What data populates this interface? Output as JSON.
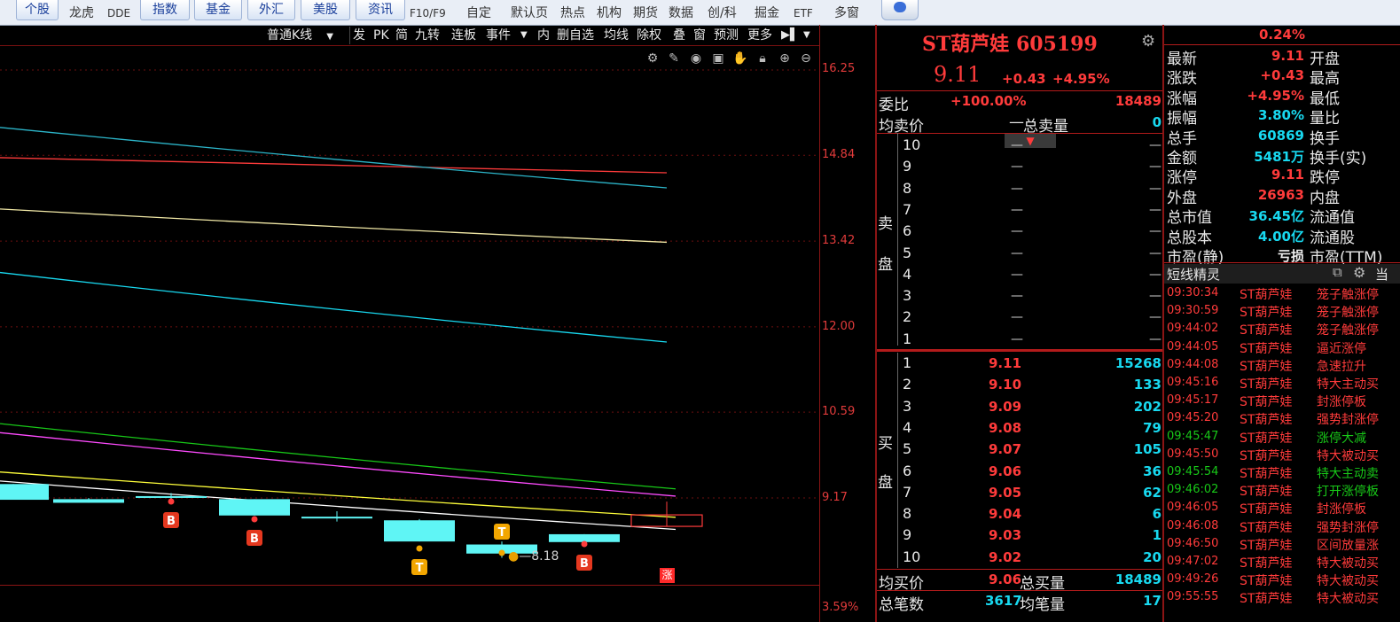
{
  "nav": {
    "buttons": [
      "个股",
      "指数",
      "基金",
      "外汇",
      "美股",
      "资讯"
    ],
    "texts": [
      "龙虎",
      "DDE",
      "F10/F9",
      "自定",
      "默认页",
      "热点",
      "机构",
      "期货",
      "数据",
      "创/科",
      "掘金",
      "ETF",
      "多窗"
    ]
  },
  "toolbar": {
    "kline_select": "普通K线",
    "items": [
      "发",
      "PK",
      "简",
      "九转",
      "连板",
      "事件",
      "内",
      "删自选",
      "均线",
      "除权",
      "叠",
      "窗",
      "预测",
      "更多"
    ]
  },
  "chart": {
    "y_labels": [
      "16.25",
      "14.84",
      "13.42",
      "12.00",
      "10.59",
      "9.17",
      "3.59%"
    ],
    "min_label": "8.18",
    "markers": [
      "B",
      "B",
      "T",
      "T",
      "B"
    ],
    "limit_up_label": "涨"
  },
  "chart_data": {
    "type": "candlestick",
    "ylim": [
      8.18,
      16.25
    ],
    "y_ticks": [
      16.25,
      14.84,
      13.42,
      12.0,
      10.59,
      9.17
    ],
    "candles": [
      {
        "open": 9.4,
        "close": 9.14,
        "high": 9.4,
        "low": 9.14
      },
      {
        "open": 9.15,
        "close": 9.09,
        "high": 9.17,
        "low": 9.09
      },
      {
        "open": 9.2,
        "close": 9.19,
        "high": 9.25,
        "low": 9.13
      },
      {
        "open": 9.15,
        "close": 8.88,
        "high": 9.15,
        "low": 8.88
      },
      {
        "open": 8.86,
        "close": 8.84,
        "high": 8.95,
        "low": 8.78
      },
      {
        "open": 8.8,
        "close": 8.45,
        "high": 8.82,
        "low": 8.45
      },
      {
        "open": 8.4,
        "close": 8.25,
        "high": 8.45,
        "low": 8.18
      },
      {
        "open": 8.57,
        "close": 8.44,
        "high": 8.57,
        "low": 8.44
      },
      {
        "open": 8.7,
        "close": 8.89,
        "high": 9.11,
        "low": 8.7
      }
    ],
    "moving_averages": [
      {
        "color": "#ff3b3b",
        "start": 14.8,
        "end": 14.55
      },
      {
        "color": "#2cb5c9",
        "start": 15.3,
        "end": 14.3
      },
      {
        "color": "#f1e8a6",
        "start": 13.95,
        "end": 13.4
      },
      {
        "color": "#18d9f0",
        "start": 12.9,
        "end": 11.75
      },
      {
        "color": "#18c818",
        "start": 10.4,
        "end": 9.32
      },
      {
        "color": "#ff4bff",
        "start": 10.25,
        "end": 9.2
      },
      {
        "color": "#ffff3b",
        "start": 9.6,
        "end": 8.85
      },
      {
        "color": "#ffffff",
        "start": 9.45,
        "end": 8.65
      }
    ]
  },
  "quote": {
    "name": "ST葫芦娃",
    "code": "605199",
    "price": "9.11",
    "change": "+0.43",
    "change_pct": "+4.95%",
    "weibi_label": "委比",
    "weibi": "+100.00%",
    "weicha": "18489",
    "avg_sell_label": "均卖价",
    "avg_sell": "—",
    "total_sell_label": "总卖量",
    "total_sell": "0",
    "sell_side_label": [
      "卖",
      "盘"
    ],
    "buy_side_label": [
      "买",
      "盘"
    ],
    "sell_levels": [
      {
        "lvl": "10",
        "price": "—",
        "vol": "—"
      },
      {
        "lvl": "9",
        "price": "—",
        "vol": "—"
      },
      {
        "lvl": "8",
        "price": "—",
        "vol": "—"
      },
      {
        "lvl": "7",
        "price": "—",
        "vol": "—"
      },
      {
        "lvl": "6",
        "price": "—",
        "vol": "—"
      },
      {
        "lvl": "5",
        "price": "—",
        "vol": "—"
      },
      {
        "lvl": "4",
        "price": "—",
        "vol": "—"
      },
      {
        "lvl": "3",
        "price": "—",
        "vol": "—"
      },
      {
        "lvl": "2",
        "price": "—",
        "vol": "—"
      },
      {
        "lvl": "1",
        "price": "—",
        "vol": "—"
      }
    ],
    "buy_levels": [
      {
        "lvl": "1",
        "price": "9.11",
        "vol": "15268"
      },
      {
        "lvl": "2",
        "price": "9.10",
        "vol": "133"
      },
      {
        "lvl": "3",
        "price": "9.09",
        "vol": "202"
      },
      {
        "lvl": "4",
        "price": "9.08",
        "vol": "79"
      },
      {
        "lvl": "5",
        "price": "9.07",
        "vol": "105"
      },
      {
        "lvl": "6",
        "price": "9.06",
        "vol": "36"
      },
      {
        "lvl": "7",
        "price": "9.05",
        "vol": "62"
      },
      {
        "lvl": "8",
        "price": "9.04",
        "vol": "6"
      },
      {
        "lvl": "9",
        "price": "9.03",
        "vol": "1"
      },
      {
        "lvl": "10",
        "price": "9.02",
        "vol": "20"
      }
    ],
    "avg_buy_label": "均买价",
    "avg_buy": "9.06",
    "total_buy_label": "总买量",
    "total_buy": "18489",
    "total_trades_label": "总笔数",
    "total_trades": "3617",
    "avg_trade_label": "均笔量",
    "avg_trade": "17"
  },
  "stats": {
    "top_pct": "0.24%",
    "rows": [
      {
        "label": "最新",
        "value": "9.11",
        "color": "red",
        "label2": "开盘"
      },
      {
        "label": "涨跌",
        "value": "+0.43",
        "color": "red",
        "label2": "最高"
      },
      {
        "label": "涨幅",
        "value": "+4.95%",
        "color": "red",
        "label2": "最低"
      },
      {
        "label": "振幅",
        "value": "3.80%",
        "color": "cyan",
        "label2": "量比"
      },
      {
        "label": "总手",
        "value": "60869",
        "color": "cyan",
        "label2": "换手"
      },
      {
        "label": "金额",
        "value": "5481万",
        "color": "cyan",
        "label2": "换手(实)"
      },
      {
        "label": "涨停",
        "value": "9.11",
        "color": "red",
        "label2": "跌停"
      },
      {
        "label": "外盘",
        "value": "26963",
        "color": "red",
        "label2": "内盘"
      },
      {
        "label": "总市值",
        "value": "36.45亿",
        "color": "cyan",
        "label2": "流通值"
      },
      {
        "label": "总股本",
        "value": "4.00亿",
        "color": "cyan",
        "label2": "流通股"
      },
      {
        "label": "市盈(静)",
        "value": "亏损",
        "color": "white",
        "label2": "市盈(TTM)"
      }
    ]
  },
  "alerts": {
    "title": "短线精灵",
    "tab_label": "当",
    "items": [
      {
        "time": "09:30:34",
        "name": "ST葫芦娃",
        "event": "笼子触涨停",
        "color": "red"
      },
      {
        "time": "09:30:59",
        "name": "ST葫芦娃",
        "event": "笼子触涨停",
        "color": "red"
      },
      {
        "time": "09:44:02",
        "name": "ST葫芦娃",
        "event": "笼子触涨停",
        "color": "red"
      },
      {
        "time": "09:44:05",
        "name": "ST葫芦娃",
        "event": "逼近涨停",
        "color": "red"
      },
      {
        "time": "09:44:08",
        "name": "ST葫芦娃",
        "event": "急速拉升",
        "color": "red"
      },
      {
        "time": "09:45:16",
        "name": "ST葫芦娃",
        "event": "特大主动买",
        "color": "red"
      },
      {
        "time": "09:45:17",
        "name": "ST葫芦娃",
        "event": "封涨停板",
        "color": "red"
      },
      {
        "time": "09:45:20",
        "name": "ST葫芦娃",
        "event": "强势封涨停",
        "color": "red"
      },
      {
        "time": "09:45:47",
        "name": "ST葫芦娃",
        "event": "涨停大减",
        "color": "green"
      },
      {
        "time": "09:45:50",
        "name": "ST葫芦娃",
        "event": "特大被动买",
        "color": "red"
      },
      {
        "time": "09:45:54",
        "name": "ST葫芦娃",
        "event": "特大主动卖",
        "color": "green"
      },
      {
        "time": "09:46:02",
        "name": "ST葫芦娃",
        "event": "打开涨停板",
        "color": "green"
      },
      {
        "time": "09:46:05",
        "name": "ST葫芦娃",
        "event": "封涨停板",
        "color": "red"
      },
      {
        "time": "09:46:08",
        "name": "ST葫芦娃",
        "event": "强势封涨停",
        "color": "red"
      },
      {
        "time": "09:46:50",
        "name": "ST葫芦娃",
        "event": "区间放量涨",
        "color": "red"
      },
      {
        "time": "09:47:02",
        "name": "ST葫芦娃",
        "event": "特大被动买",
        "color": "red"
      },
      {
        "time": "09:49:26",
        "name": "ST葫芦娃",
        "event": "特大被动买",
        "color": "red"
      },
      {
        "time": "09:55:55",
        "name": "ST葫芦娃",
        "event": "特大被动买",
        "color": "red"
      }
    ]
  }
}
